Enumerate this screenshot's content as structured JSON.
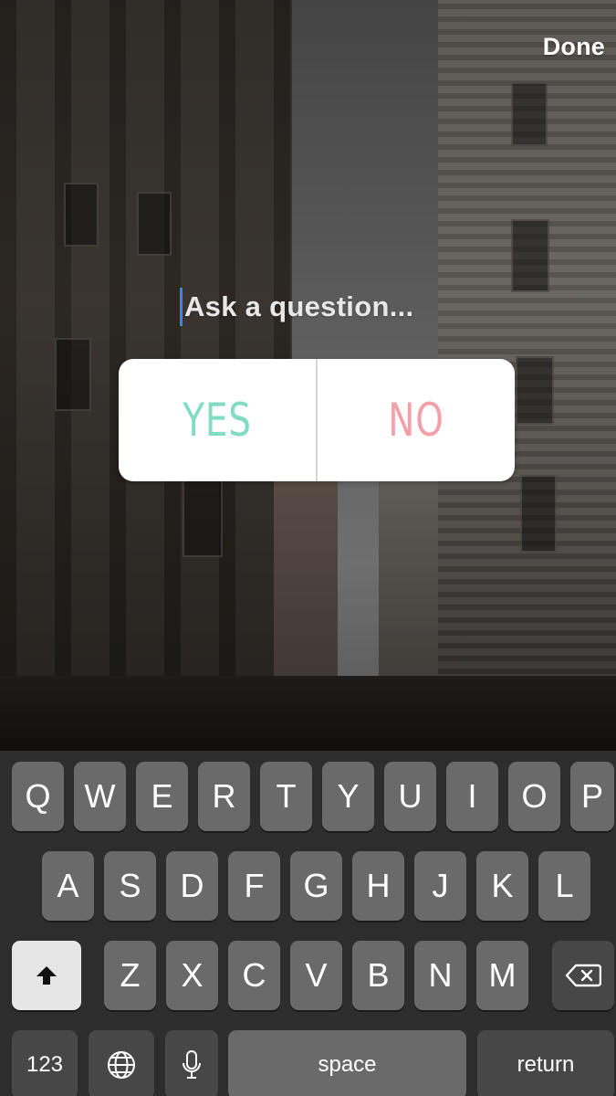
{
  "header": {
    "done_label": "Done"
  },
  "question": {
    "placeholder": "Ask a question..."
  },
  "poll": {
    "options": [
      {
        "label": "YES",
        "color": "#80dcc4"
      },
      {
        "label": "NO",
        "color": "#f3a0a8"
      }
    ]
  },
  "keyboard": {
    "row1": [
      "Q",
      "W",
      "E",
      "R",
      "T",
      "Y",
      "U",
      "I",
      "O",
      "P"
    ],
    "row2": [
      "A",
      "S",
      "D",
      "F",
      "G",
      "H",
      "J",
      "K",
      "L"
    ],
    "row3": [
      "Z",
      "X",
      "C",
      "V",
      "B",
      "N",
      "M"
    ],
    "numbers_label": "123",
    "space_label": "space",
    "return_label": "return",
    "icons": {
      "shift": "shift-arrow-icon",
      "delete": "backspace-icon",
      "globe": "globe-icon",
      "mic": "microphone-icon"
    }
  },
  "colors": {
    "caret": "#3b82f6",
    "keyboard_bg": "#2d2d2d",
    "key": "#6a6a6a",
    "key_dark": "#474747"
  }
}
